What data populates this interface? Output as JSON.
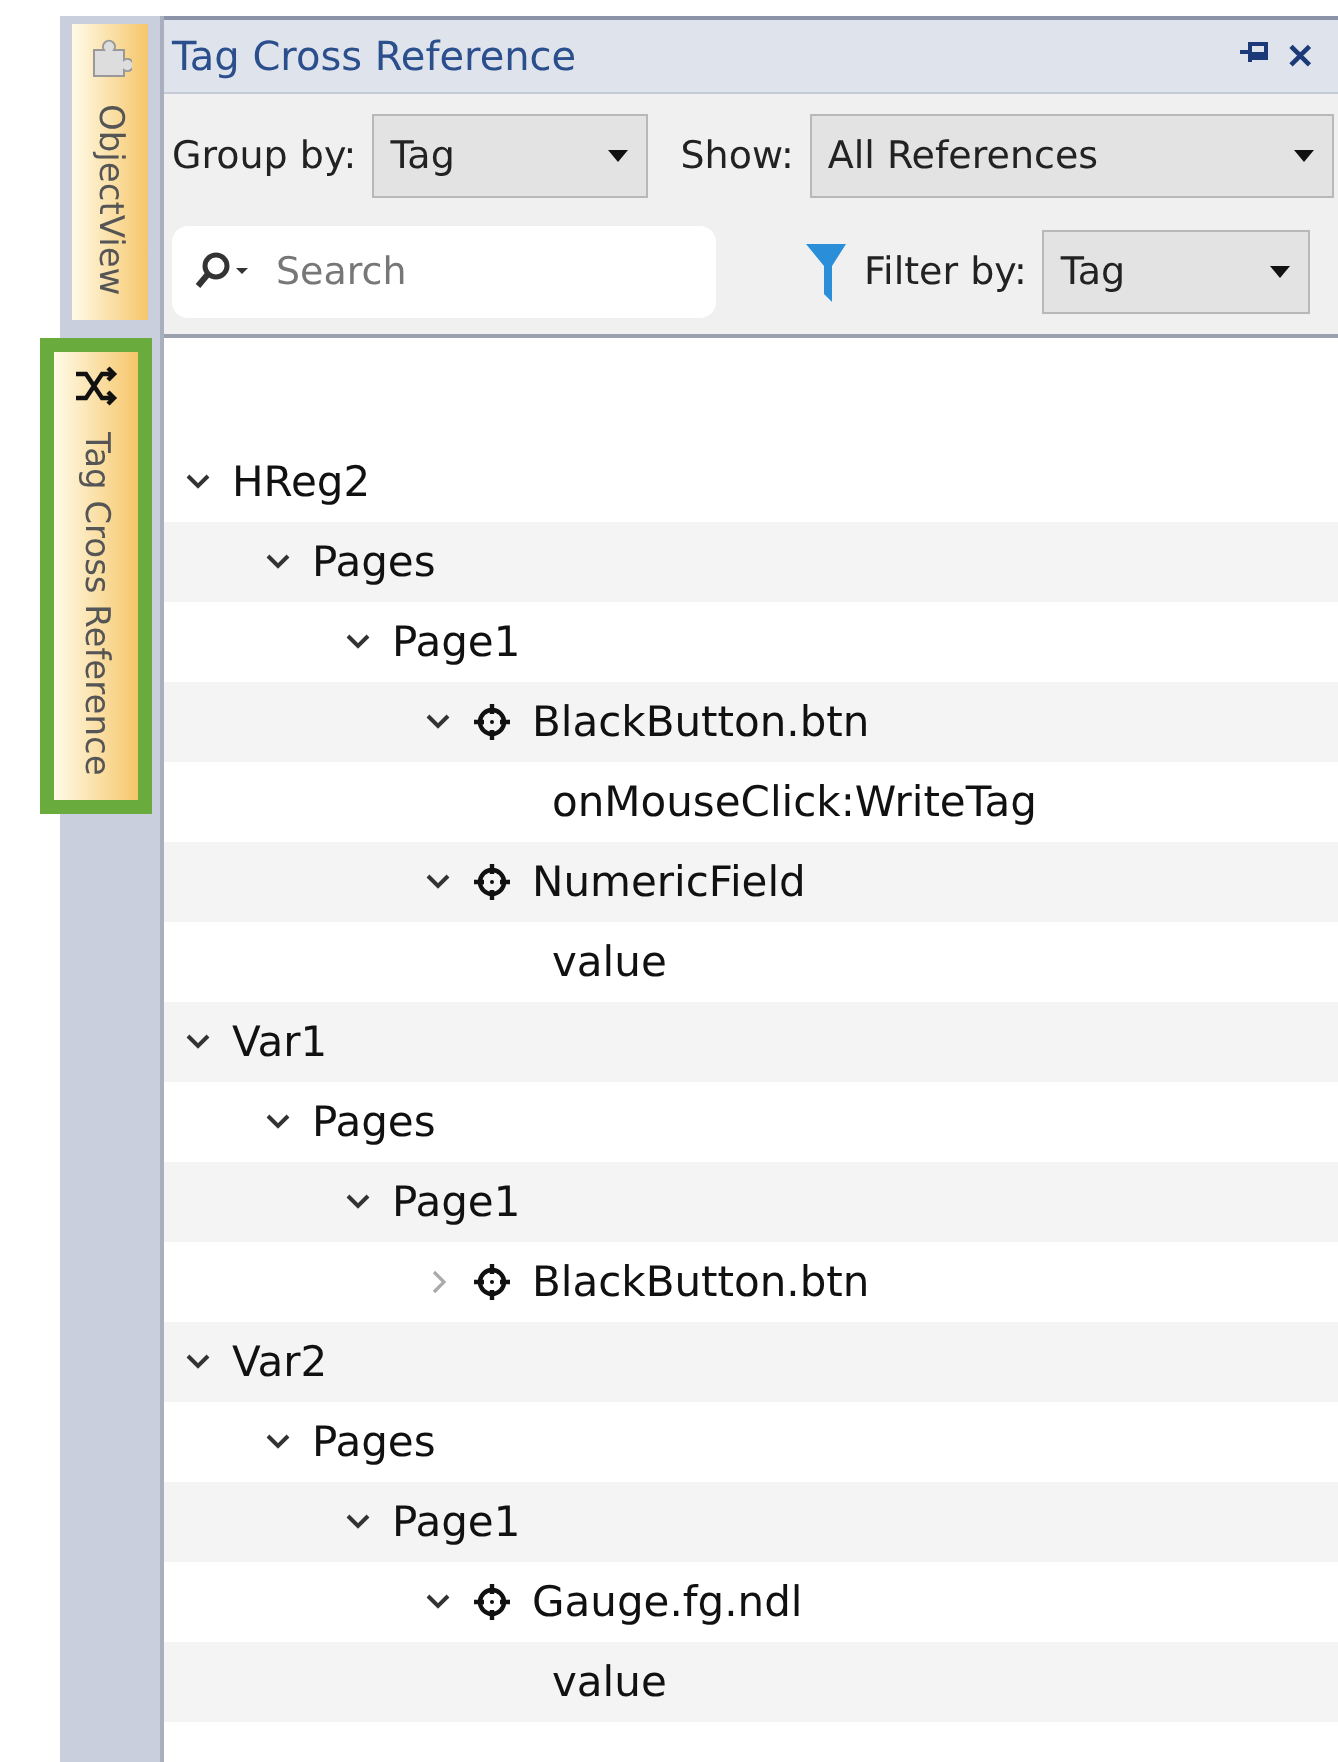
{
  "side_tabs": [
    {
      "label": "ObjectView",
      "selected": false,
      "kind": "puzzle"
    },
    {
      "label": "Tag Cross Reference",
      "selected": true,
      "kind": "shuffle"
    }
  ],
  "panel": {
    "title": "Tag Cross Reference",
    "close": "✕"
  },
  "toolbar": {
    "group_by": {
      "label": "Group by:",
      "value": "Tag"
    },
    "show": {
      "label": "Show:",
      "value": "All References"
    },
    "search": {
      "placeholder": "Search"
    },
    "filter_by": {
      "label": "Filter by:",
      "value": "Tag"
    }
  },
  "tree": [
    {
      "label": "HReg2",
      "kind": "group",
      "expanded": true,
      "children": [
        {
          "label": "Pages",
          "kind": "group",
          "expanded": true,
          "children": [
            {
              "label": "Page1",
              "kind": "group",
              "expanded": true,
              "children": [
                {
                  "label": "BlackButton.btn",
                  "kind": "object",
                  "expanded": true,
                  "children": [
                    {
                      "label": "onMouseClick:WriteTag",
                      "kind": "leaf"
                    }
                  ]
                },
                {
                  "label": "NumericField",
                  "kind": "object",
                  "expanded": true,
                  "children": [
                    {
                      "label": "value",
                      "kind": "leaf"
                    }
                  ]
                }
              ]
            }
          ]
        }
      ]
    },
    {
      "label": "Var1",
      "kind": "group",
      "expanded": true,
      "children": [
        {
          "label": "Pages",
          "kind": "group",
          "expanded": true,
          "children": [
            {
              "label": "Page1",
              "kind": "group",
              "expanded": true,
              "children": [
                {
                  "label": "BlackButton.btn",
                  "kind": "object",
                  "expanded": false
                }
              ]
            }
          ]
        }
      ]
    },
    {
      "label": "Var2",
      "kind": "group",
      "expanded": true,
      "children": [
        {
          "label": "Pages",
          "kind": "group",
          "expanded": true,
          "children": [
            {
              "label": "Page1",
              "kind": "group",
              "expanded": true,
              "children": [
                {
                  "label": "Gauge.fg.ndl",
                  "kind": "object",
                  "expanded": true,
                  "children": [
                    {
                      "label": "value",
                      "kind": "leaf"
                    }
                  ]
                }
              ]
            }
          ]
        }
      ]
    }
  ]
}
